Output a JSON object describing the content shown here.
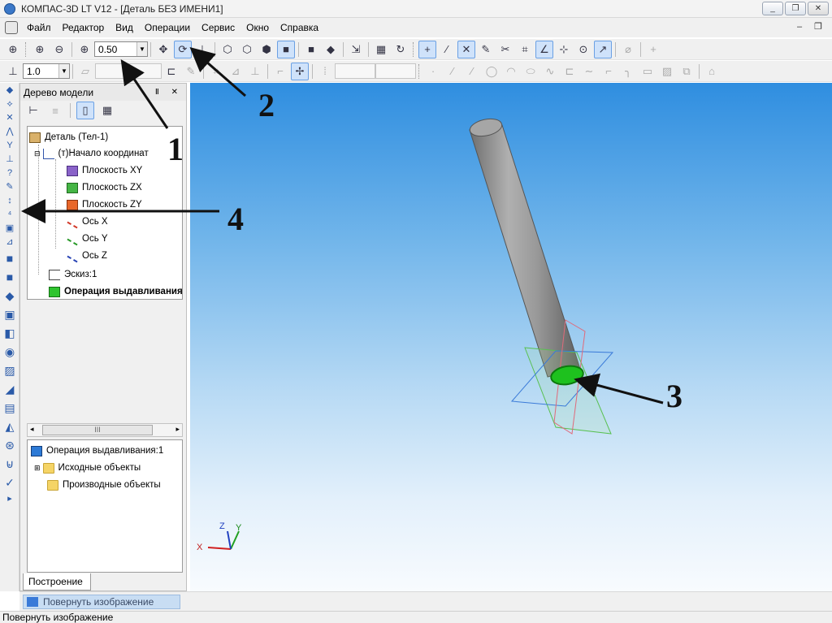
{
  "window": {
    "title": "КОМПАС-3D LT V12 - [Деталь БЕЗ ИМЕНИ1]",
    "min_label": "_",
    "max_label": "❐",
    "close_label": "✕"
  },
  "menu": {
    "items": [
      {
        "label": "Файл"
      },
      {
        "label": "Редактор"
      },
      {
        "label": "Вид"
      },
      {
        "label": "Операции"
      },
      {
        "label": "Сервис"
      },
      {
        "label": "Окно"
      },
      {
        "label": "Справка"
      }
    ],
    "mdi_controls": "– ❐"
  },
  "toolbar": {
    "zoom_value": "0.50",
    "step_value": "1.0"
  },
  "tree_panel": {
    "title": "Дерево модели",
    "pin": "Ⅱ ✕",
    "nodes": [
      {
        "label": "Деталь (Тел-1)"
      },
      {
        "label": "(т)Начало координат"
      },
      {
        "label": "Плоскость XY"
      },
      {
        "label": "Плоскость ZX"
      },
      {
        "label": "Плоскость ZY"
      },
      {
        "label": "Ось X"
      },
      {
        "label": "Ось Y"
      },
      {
        "label": "Ось Z"
      },
      {
        "label": "Эскиз:1"
      },
      {
        "label": "Операция выдавливания"
      }
    ],
    "scroll_thumb": "III",
    "properties": {
      "title": "Операция выдавливания:1",
      "items": [
        {
          "label": "Исходные объекты"
        },
        {
          "label": "Производные объекты"
        }
      ]
    },
    "tab_label": "Построение"
  },
  "command": {
    "label": "Повернуть изображение"
  },
  "status": {
    "text": "Повернуть изображение"
  },
  "axes": {
    "x": "X",
    "y": "Y",
    "z": "Z"
  },
  "callouts": {
    "one": "1",
    "two": "2",
    "three": "3",
    "four": "4"
  },
  "colors": {
    "viewport_top": "#2f8ee0",
    "viewport_bottom": "#f8fbfe",
    "selected_face": "#1ec11e",
    "cylinder": "#8c8c8c"
  }
}
